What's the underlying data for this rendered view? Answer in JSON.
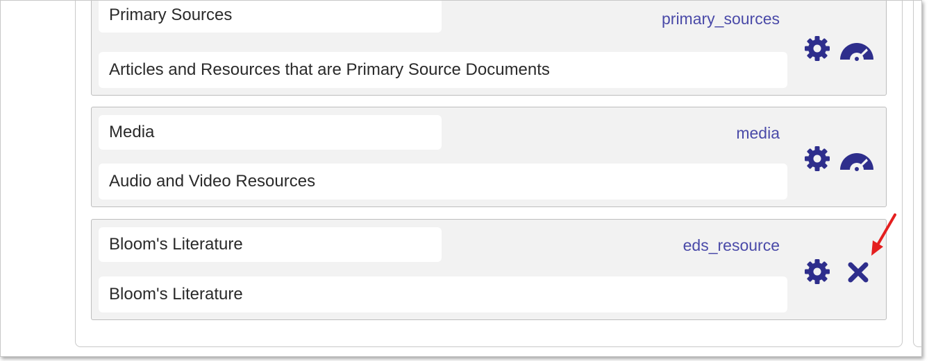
{
  "colors": {
    "icon": "#2e2e8c",
    "key_text": "#4a4aa8",
    "arrow": "#e41f1f"
  },
  "resources": [
    {
      "name": "Primary Sources",
      "key": "primary_sources",
      "description": "Articles and Resources that are Primary Source Documents",
      "actions": [
        "gear-icon",
        "dashboard-icon"
      ]
    },
    {
      "name": "Media",
      "key": "media",
      "description": "Audio and Video Resources",
      "actions": [
        "gear-icon",
        "dashboard-icon"
      ]
    },
    {
      "name": "Bloom's Literature",
      "key": "eds_resource",
      "description": "Bloom's Literature",
      "actions": [
        "gear-icon",
        "close-icon"
      ]
    }
  ],
  "annotation": {
    "icon": "arrow-icon",
    "points_to": "close-icon"
  }
}
